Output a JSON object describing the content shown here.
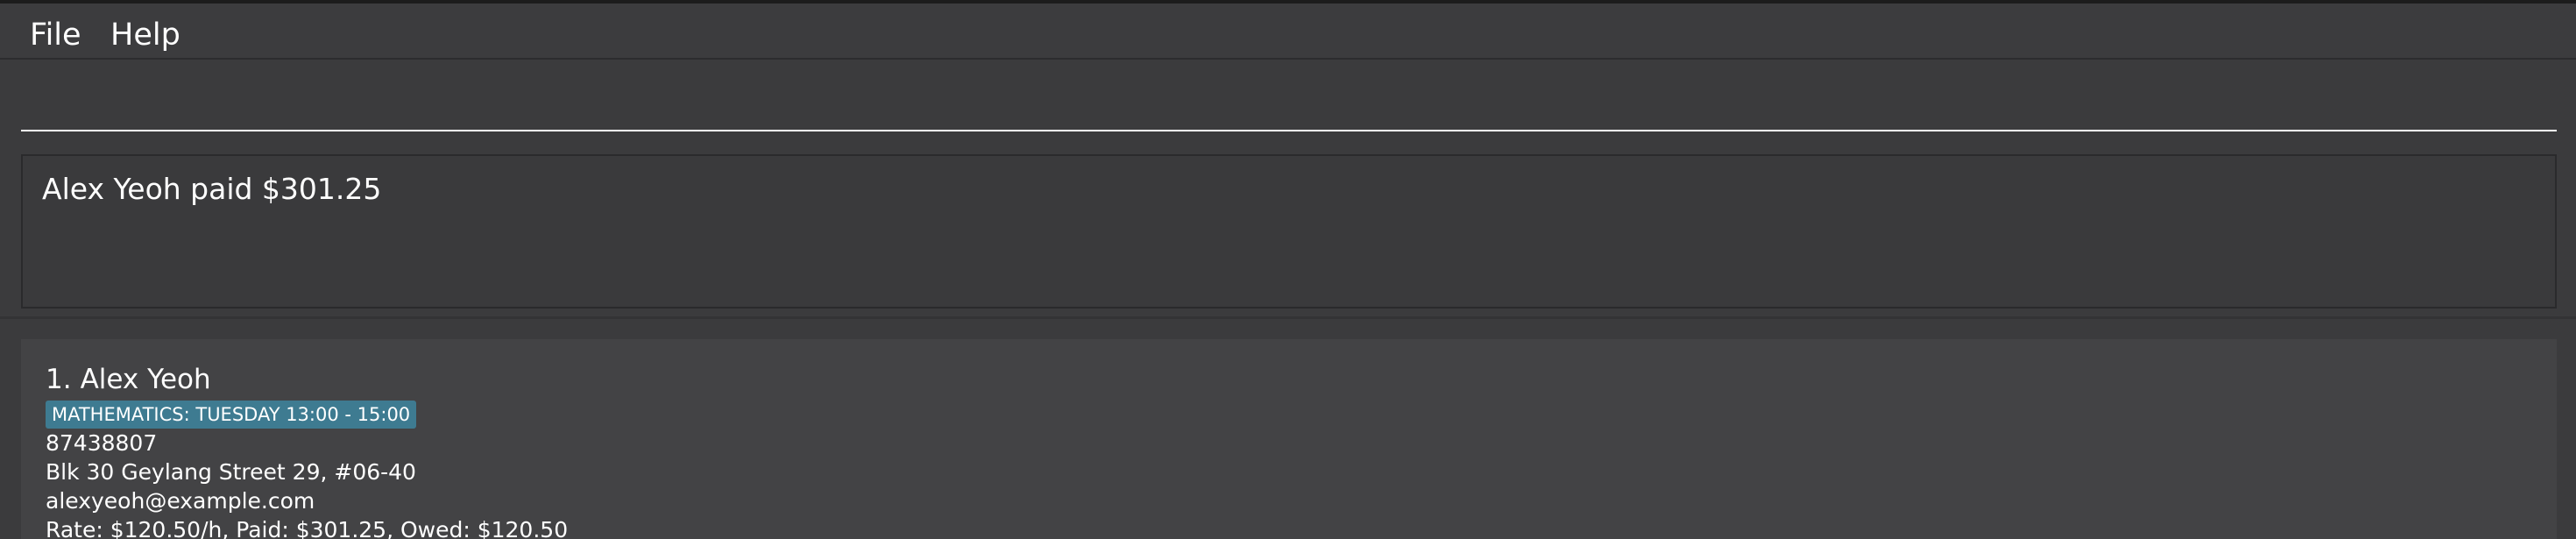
{
  "menu": {
    "items": [
      {
        "label": "File"
      },
      {
        "label": "Help"
      }
    ]
  },
  "command_box": {
    "value": "",
    "placeholder": ""
  },
  "result_display": {
    "text": "Alex Yeoh paid $301.25"
  },
  "person_list": {
    "persons": [
      {
        "index": "1.",
        "name": "Alex Yeoh",
        "tags": [
          "MATHEMATICS: TUESDAY 13:00 - 15:00"
        ],
        "phone": "87438807",
        "address": "Blk 30 Geylang Street 29, #06-40",
        "email": "alexyeoh@example.com",
        "payment": "Rate: $120.50/h, Paid: $301.25, Owed: $120.50"
      }
    ]
  },
  "colors": {
    "background": "#3b3b3d",
    "card": "#434345",
    "tag": "#3e7b91",
    "text": "#ffffff"
  }
}
